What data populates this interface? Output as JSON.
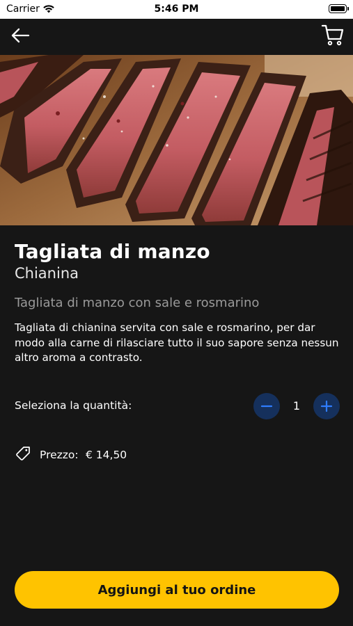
{
  "status_bar": {
    "carrier": "Carrier",
    "time": "5:46 PM"
  },
  "nav": {
    "back_icon": "arrow-left-icon",
    "cart_icon": "cart-icon"
  },
  "hero": {
    "image_alt": "Grilled sliced beef steak",
    "pager": {
      "count": 1,
      "active": 0
    }
  },
  "product": {
    "name": "Tagliata di manzo",
    "subtitle": "Chianina",
    "short_description": "Tagliata di manzo con sale e rosmarino",
    "description": "Tagliata di chianina servita con sale e rosmarino, per dar modo alla carne di rilasciare tutto il suo sapore senza nessun altro aroma a contrasto."
  },
  "quantity": {
    "label": "Seleziona la quantità:",
    "value": "1",
    "minus_icon": "minus-icon",
    "plus_icon": "plus-icon"
  },
  "price": {
    "icon": "tag-icon",
    "label": "Prezzo:",
    "value": "€ 14,50"
  },
  "cta": {
    "label": "Aggiungi al tuo ordine"
  },
  "colors": {
    "background": "#161616",
    "accent": "#ffc300",
    "stepper": "#15305c",
    "stepper_icon": "#2f7dff",
    "pager_dot": "#1f7fff"
  }
}
